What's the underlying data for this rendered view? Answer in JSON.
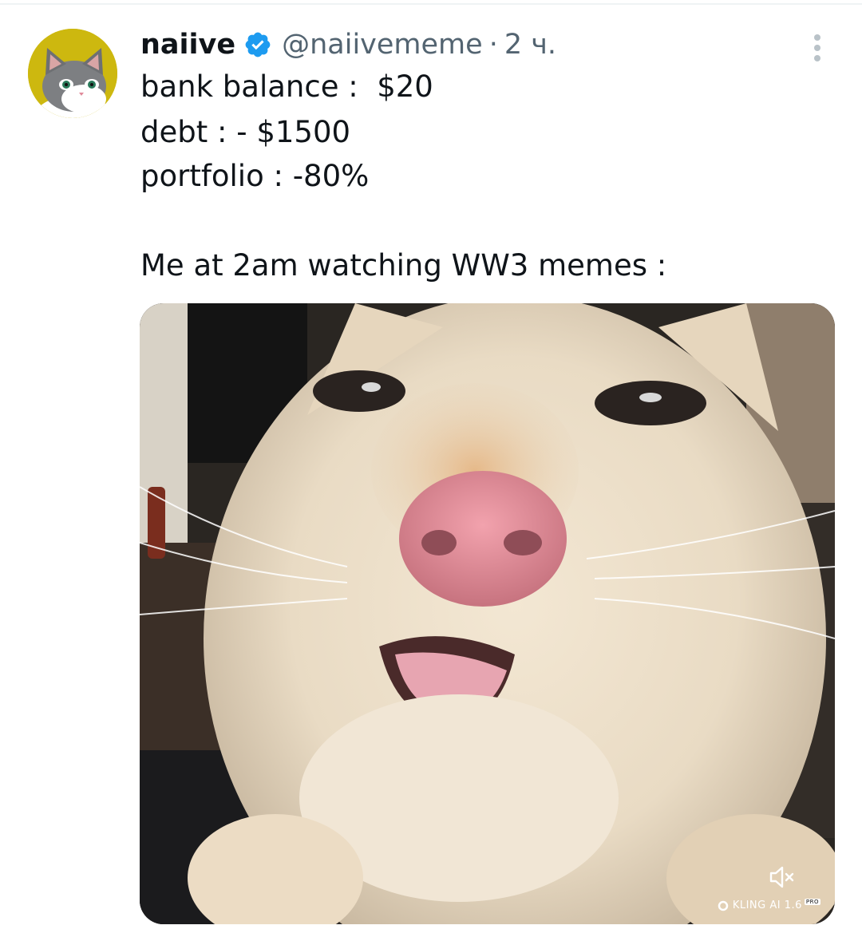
{
  "tweet": {
    "display_name": "naiive",
    "handle": "@naiivememe",
    "separator": "·",
    "time": "2 ч.",
    "lines": [
      "bank balance :  $20",
      "debt : - $1500",
      "portfolio : -80%",
      "Me at 2am watching WW3 memes :"
    ]
  },
  "media": {
    "watermark_text": "KLING AI 1.6",
    "watermark_badge": "PRO",
    "mute_icon": "speaker-muted-icon"
  },
  "icons": {
    "verified": "verified-badge-icon",
    "more": "more-options-icon"
  },
  "colors": {
    "verified_blue": "#1d9bf0",
    "secondary_text": "#536471",
    "avatar_bg": "#cdb80f"
  }
}
